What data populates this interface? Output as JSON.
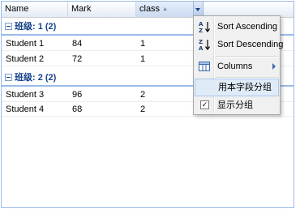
{
  "grid": {
    "columns": [
      {
        "label": "Name"
      },
      {
        "label": "Mark"
      },
      {
        "label": "class"
      }
    ],
    "groups": [
      {
        "title": "班级: 1 (2)",
        "rows": [
          {
            "name": "Student 1",
            "mark": "84",
            "class": "1"
          },
          {
            "name": "Student 2",
            "mark": "72",
            "class": "1"
          }
        ]
      },
      {
        "title": "班级: 2 (2)",
        "rows": [
          {
            "name": "Student 3",
            "mark": "96",
            "class": "2"
          },
          {
            "name": "Student 4",
            "mark": "68",
            "class": "2"
          }
        ]
      }
    ]
  },
  "menu": {
    "sort_asc": "Sort Ascending",
    "sort_desc": "Sort Descending",
    "columns": "Columns",
    "group_by": "用本字段分组",
    "show_groups": "显示分组",
    "show_groups_checked": true
  },
  "colors": {
    "group_text": "#15428b",
    "border": "#99bbe8",
    "menu_highlight": "#e0ebf8"
  }
}
